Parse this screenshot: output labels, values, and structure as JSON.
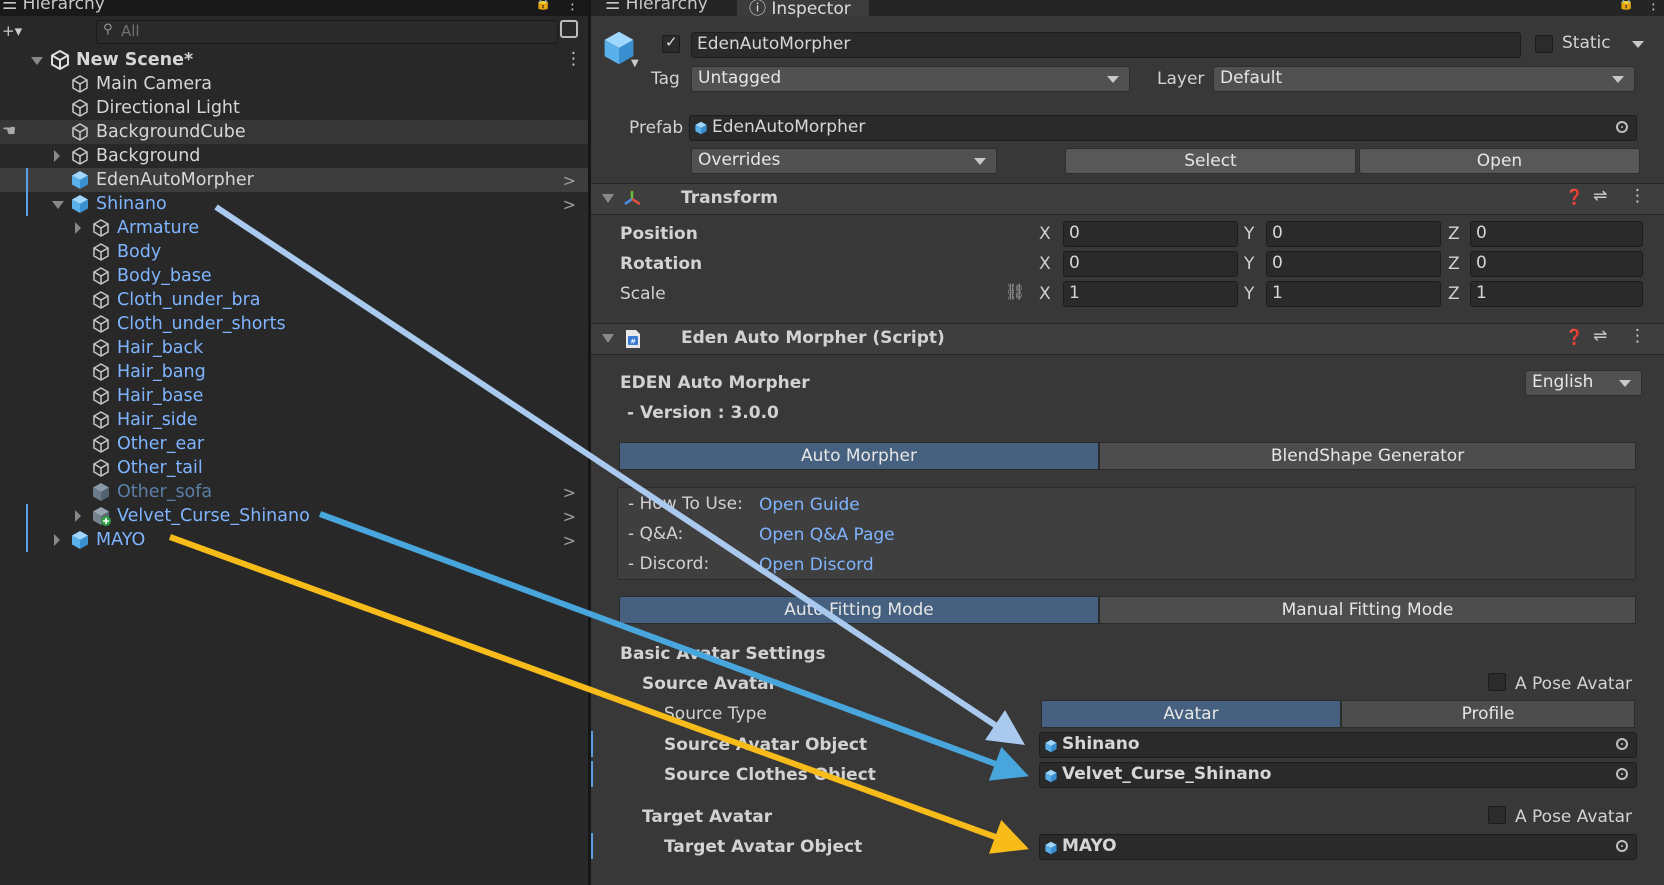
{
  "hierarchy": {
    "tab_label": "Hierarchy",
    "search_placeholder": "All",
    "scene": "New Scene*",
    "items": [
      {
        "label": "Main Camera"
      },
      {
        "label": "Directional Light"
      },
      {
        "label": "BackgroundCube"
      },
      {
        "label": "Background"
      },
      {
        "label": "EdenAutoMorpher"
      },
      {
        "label": "Shinano"
      },
      {
        "label": "Armature"
      },
      {
        "label": "Body"
      },
      {
        "label": "Body_base"
      },
      {
        "label": "Cloth_under_bra"
      },
      {
        "label": "Cloth_under_shorts"
      },
      {
        "label": "Hair_back"
      },
      {
        "label": "Hair_bang"
      },
      {
        "label": "Hair_base"
      },
      {
        "label": "Hair_side"
      },
      {
        "label": "Other_ear"
      },
      {
        "label": "Other_tail"
      },
      {
        "label": "Other_sofa"
      },
      {
        "label": "Velvet_Curse_Shinano"
      },
      {
        "label": "MAYO"
      }
    ]
  },
  "inspector": {
    "tabs": [
      "Hierarchy",
      "Inspector"
    ],
    "object_name": "EdenAutoMorpher",
    "static_label": "Static",
    "tag_label": "Tag",
    "tag_value": "Untagged",
    "layer_label": "Layer",
    "layer_value": "Default",
    "prefab_label": "Prefab",
    "prefab_value": "EdenAutoMorpher",
    "overrides_label": "Overrides",
    "select_label": "Select",
    "open_label": "Open",
    "transform": {
      "title": "Transform",
      "position_label": "Position",
      "rotation_label": "Rotation",
      "scale_label": "Scale",
      "axis_x": "X",
      "axis_y": "Y",
      "axis_z": "Z",
      "position": [
        "0",
        "0",
        "0"
      ],
      "rotation": [
        "0",
        "0",
        "0"
      ],
      "scale": [
        "1",
        "1",
        "1"
      ]
    },
    "script": {
      "title": "Eden Auto Morpher (Script)",
      "heading": "EDEN Auto Morpher",
      "version": "- Version : 3.0.0",
      "language": "English",
      "tab_auto_morpher": "Auto Morpher",
      "tab_blendshape": "BlendShape Generator",
      "help": {
        "howto_label": "- How To Use:",
        "howto_link": "Open Guide",
        "qa_label": "- Q&A:",
        "qa_link": "Open Q&A Page",
        "discord_label": "- Discord:",
        "discord_link": "Open Discord"
      },
      "mode_auto": "Auto Fitting Mode",
      "mode_manual": "Manual Fitting Mode",
      "basic_settings": "Basic Avatar Settings",
      "source_avatar": "Source Avatar",
      "a_pose_label": "A Pose Avatar",
      "source_type_label": "Source Type",
      "source_type_avatar": "Avatar",
      "source_type_profile": "Profile",
      "source_avatar_object_label": "Source Avatar Object",
      "source_avatar_object_value": "Shinano",
      "source_clothes_object_label": "Source Clothes Object",
      "source_clothes_object_value": "Velvet_Curse_Shinano",
      "target_avatar": "Target Avatar",
      "target_avatar_object_label": "Target Avatar Object",
      "target_avatar_object_value": "MAYO"
    }
  },
  "colors": {
    "arrow_shinano": "#a9c9ee",
    "arrow_velvet": "#49a6dc",
    "arrow_mayo": "#f7bc1a"
  }
}
